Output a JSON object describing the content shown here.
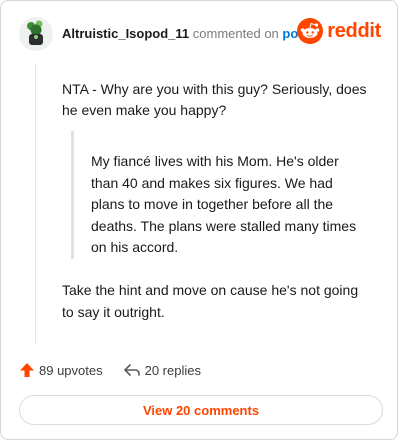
{
  "header": {
    "username": "Altruistic_Isopod_11",
    "commented_text": "commented on",
    "post_link": "post",
    "logo_text": "reddit"
  },
  "comment": {
    "intro": "NTA - Why are you with this guy? Seriously, does he even make you happy?",
    "quote": "My fiancé lives with his Mom. He's older than 40 and makes six figures. We had plans to move in together before all the deaths. The plans were stalled many times on his accord.",
    "closing": "Take the hint and move on cause he's not going to say it outright."
  },
  "actions": {
    "upvotes": "89 upvotes",
    "replies": "20 replies"
  },
  "view_button": "View 20 comments",
  "colors": {
    "accent": "#ff4500",
    "link": "#0079d3",
    "muted": "#7c7c7c"
  }
}
